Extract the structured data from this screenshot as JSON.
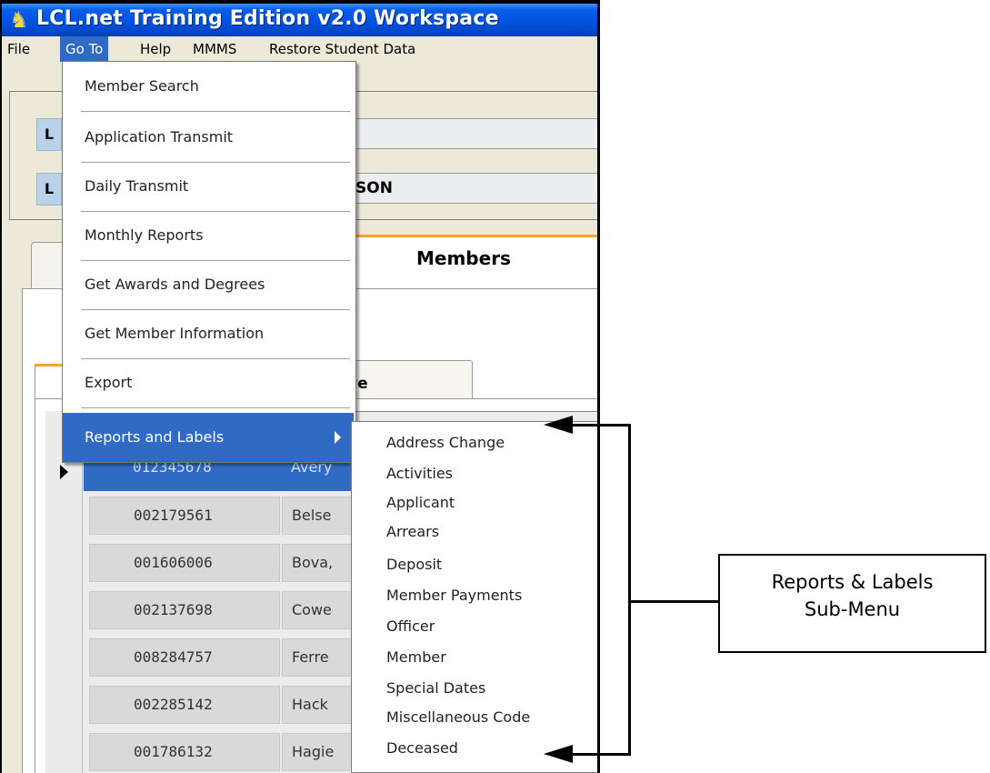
{
  "window": {
    "title": "LCL.net Training Edition v2.0 Workspace",
    "icon": "lion-icon"
  },
  "menubar": {
    "items": [
      "File",
      "Go To",
      "Help",
      "MMMS",
      "Restore Student Data"
    ],
    "active": "Go To"
  },
  "header": {
    "label1": "L",
    "label2": "L",
    "field2_value": "SON"
  },
  "tabs": {
    "members_label": "Members",
    "inner_tab_label": "ve"
  },
  "goto_menu": {
    "items": [
      "Member Search",
      "Application Transmit",
      "Daily Transmit",
      "Monthly Reports",
      "Get Awards and Degrees",
      "Get Member Information",
      "Export",
      "Reports and Labels"
    ],
    "highlighted": "Reports and Labels"
  },
  "submenu": {
    "items": [
      "Address Change",
      "Activities",
      "Applicant",
      "Arrears",
      "Deposit",
      "Member Payments",
      "Officer",
      "Member",
      "Special Dates",
      "Miscellaneous Code",
      "Deceased"
    ]
  },
  "grid": {
    "rows": [
      {
        "id": "012345678",
        "name": "Avery",
        "selected": true
      },
      {
        "id": "002179561",
        "name": "Belse"
      },
      {
        "id": "001606006",
        "name": "Bova,"
      },
      {
        "id": "002137698",
        "name": "Cowe"
      },
      {
        "id": "008284757",
        "name": "Ferre"
      },
      {
        "id": "002285142",
        "name": "Hack"
      },
      {
        "id": "001786132",
        "name": "Hagie"
      }
    ]
  },
  "annotation": {
    "line1": "Reports & Labels",
    "line2": "Sub-Menu"
  },
  "colors": {
    "titlebar": "#0054e3",
    "highlight": "#316ac5",
    "tab_accent": "#f8a428"
  }
}
